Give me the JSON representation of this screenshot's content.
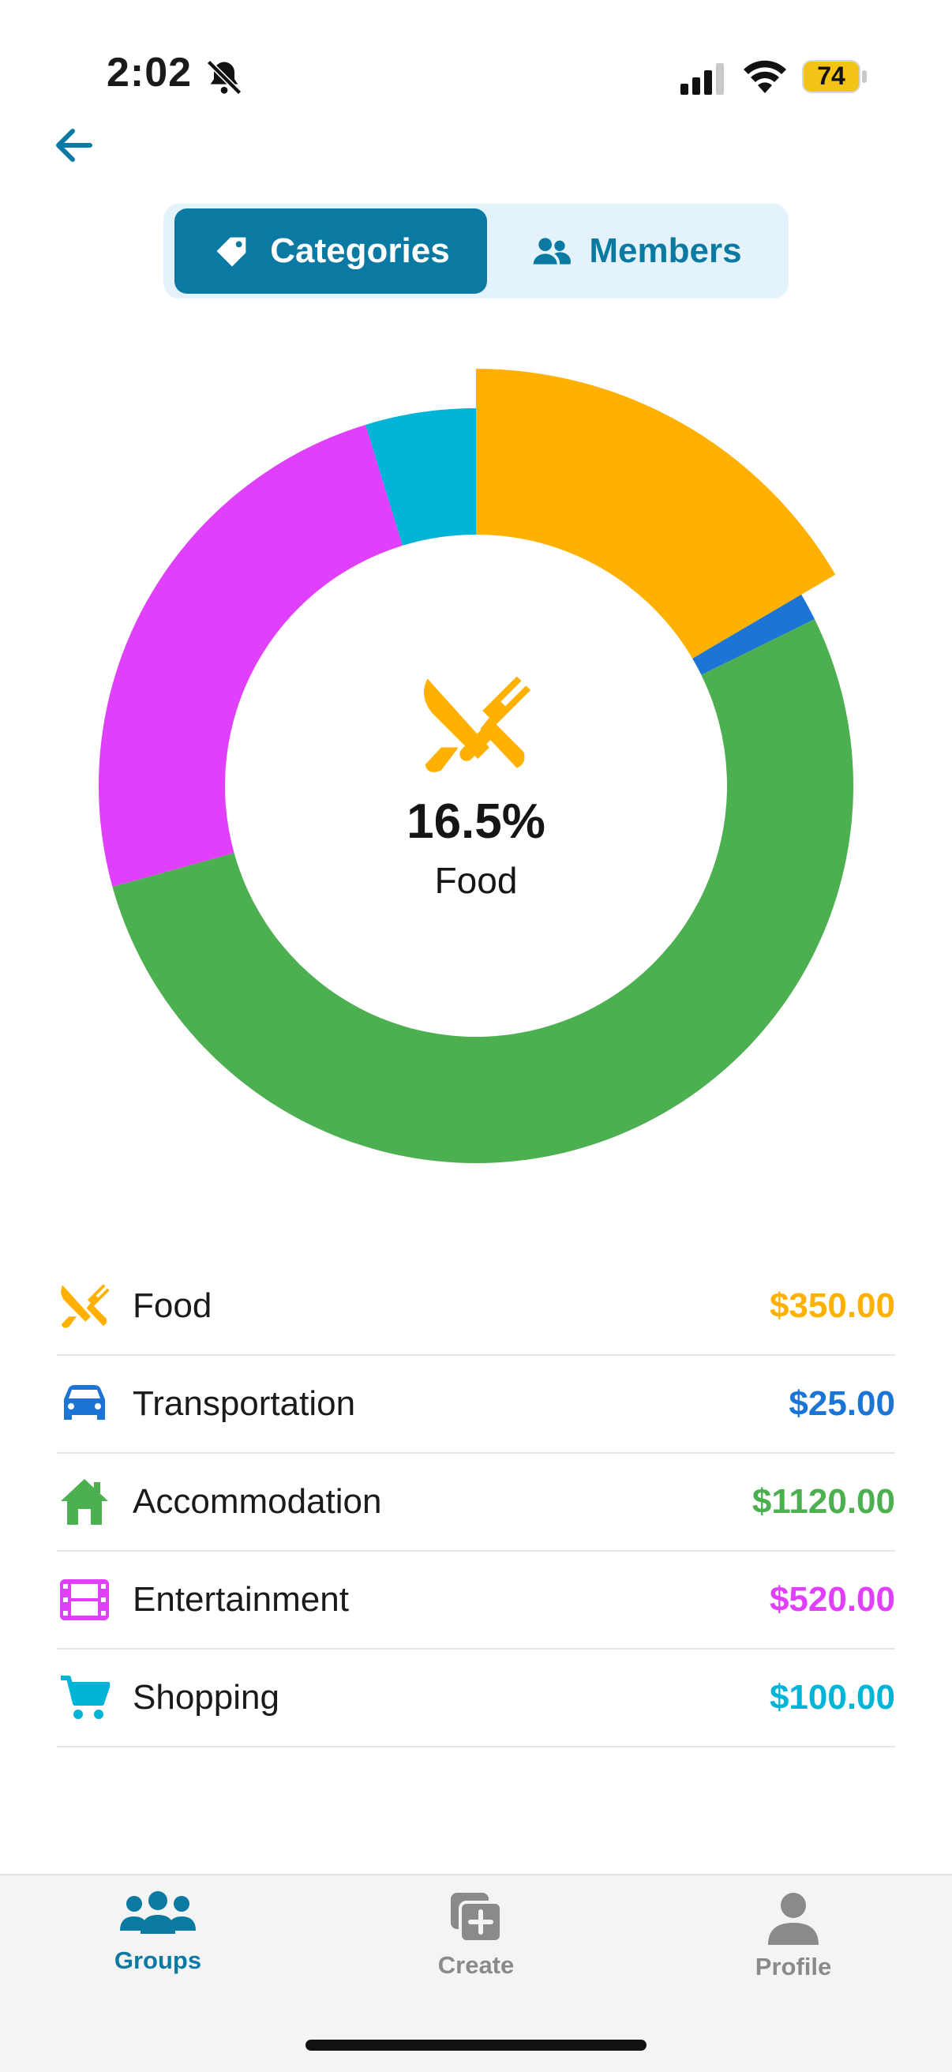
{
  "status": {
    "time": "2:02",
    "battery": "74"
  },
  "segments": {
    "categories": "Categories",
    "members": "Members",
    "active": "Categories"
  },
  "center": {
    "percent": "16.5%",
    "label": "Food"
  },
  "categories": [
    {
      "name": "Food",
      "amount": "$350.00",
      "color": "#FFB000",
      "icon": "fork-knife-icon"
    },
    {
      "name": "Transportation",
      "amount": "$25.00",
      "color": "#1C74D4",
      "icon": "car-icon"
    },
    {
      "name": "Accommodation",
      "amount": "$1120.00",
      "color": "#4CAF50",
      "icon": "house-icon"
    },
    {
      "name": "Entertainment",
      "amount": "$520.00",
      "color": "#E040FB",
      "icon": "film-icon"
    },
    {
      "name": "Shopping",
      "amount": "$100.00",
      "color": "#00B4D8",
      "icon": "cart-icon"
    }
  ],
  "chart_data": {
    "type": "pie",
    "variant": "donut",
    "categories": [
      "Food",
      "Transportation",
      "Accommodation",
      "Entertainment",
      "Shopping"
    ],
    "values": [
      350,
      25,
      1120,
      520,
      100
    ],
    "colors": [
      "#FFB000",
      "#1C74D4",
      "#4CAF50",
      "#E040FB",
      "#00B4D8"
    ],
    "highlighted": "Food"
  },
  "tabs": {
    "groups": "Groups",
    "create": "Create",
    "profile": "Profile",
    "active": "Groups"
  },
  "colors": {
    "accent": "#0B7AA3",
    "inactive": "#8A8A8A"
  }
}
